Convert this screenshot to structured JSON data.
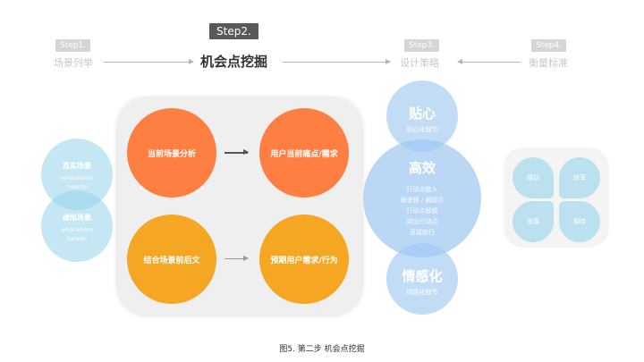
{
  "steps": [
    {
      "badge": "Step1.",
      "title": "场景列举"
    },
    {
      "badge": "Step2.",
      "title": "机会点挖掘"
    },
    {
      "badge": "Step3.",
      "title": "设计策略"
    },
    {
      "badge": "Step4.",
      "title": "衡量标准"
    }
  ],
  "left_circles": [
    {
      "title": "真实场景",
      "line1": "whatwhere",
      "line2": "howdo"
    },
    {
      "title": "虚拟场景",
      "line1": "whatwhere",
      "line2": "howdo"
    }
  ],
  "middle": {
    "top_left": "当前场景分析",
    "top_right": "用户当前痛点/需求",
    "bottom_left": "结合场景前后文",
    "bottom_right": "预期用户需求/行为"
  },
  "strategy": {
    "tiexin": {
      "title": "贴心",
      "sub": "贴心化细节"
    },
    "gaoxiao": {
      "title": "高效",
      "items": [
        "行动点植入",
        "弱逻辑 / 弱提示",
        "行动点替换",
        "突出行动点",
        "直接执行"
      ]
    },
    "qingganhua": {
      "title": "情感化",
      "sub": "情感化细节"
    }
  },
  "metrics": [
    "感动",
    "效率",
    "惊喜",
    "期待"
  ],
  "caption": "图5. 第二步 机会点挖掘",
  "colors": {
    "orange": "#ff7f43",
    "yellow": "#f5a623",
    "blue": "#9bc4f0",
    "cyan": "#96d4e9",
    "badge_active": "#595959",
    "badge_inactive": "#d5d5d5"
  }
}
